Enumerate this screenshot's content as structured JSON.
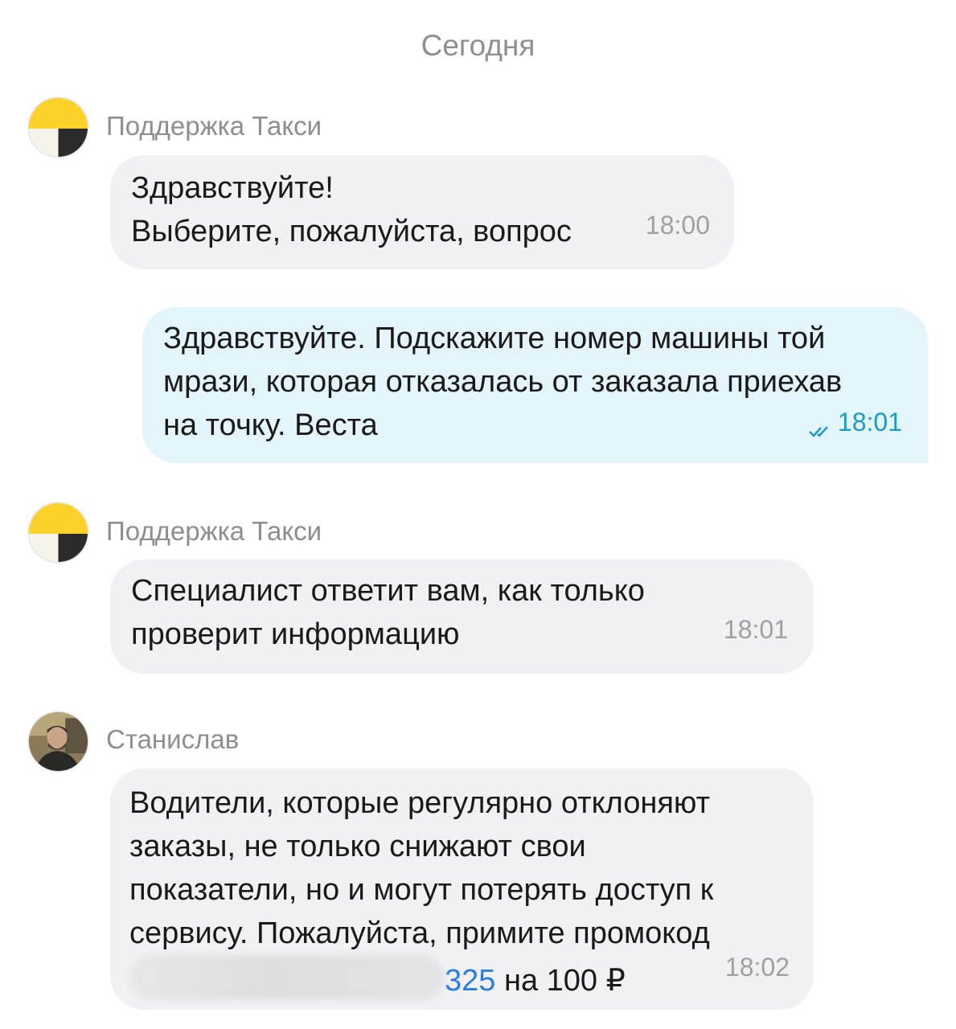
{
  "date_separator": "Сегодня",
  "colors": {
    "incoming_bubble": "#f1f1f3",
    "outgoing_bubble": "#e3f5fa",
    "outgoing_meta": "#1b9cc0",
    "link": "#2a7de1",
    "taxi_logo_yellow": "#fcd12a",
    "taxi_logo_black": "#2b2b2b"
  },
  "messages": [
    {
      "sender": "Поддержка Такси",
      "avatar_icon": "yandex-taxi-logo-icon",
      "text": "Здравствуйте!\nВыберите, пожалуйста, вопрос",
      "time": "18:00"
    },
    {
      "outgoing": true,
      "text": "Здравствуйте. Подскажите номер машины той\nмрази, которая отказалась от заказала приехав\nна точку. Веста",
      "status_icon": "double-check-icon",
      "time": "18:01"
    },
    {
      "sender": "Поддержка Такси",
      "avatar_icon": "yandex-taxi-logo-icon",
      "text": "Специалист ответит вам, как только\nпроверит информацию",
      "time": "18:01"
    },
    {
      "sender": "Станислав",
      "avatar_icon": "user-photo-avatar",
      "text": "Водители, которые регулярно отклоняют\nзаказы, не только снижают свои\nпоказатели, но и могут потерять доступ к\nсервису. Пожалуйста, примите промокод",
      "promo_code_visible_tail": "325",
      "promo_suffix": " на 100 ₽",
      "time": "18:02"
    }
  ]
}
